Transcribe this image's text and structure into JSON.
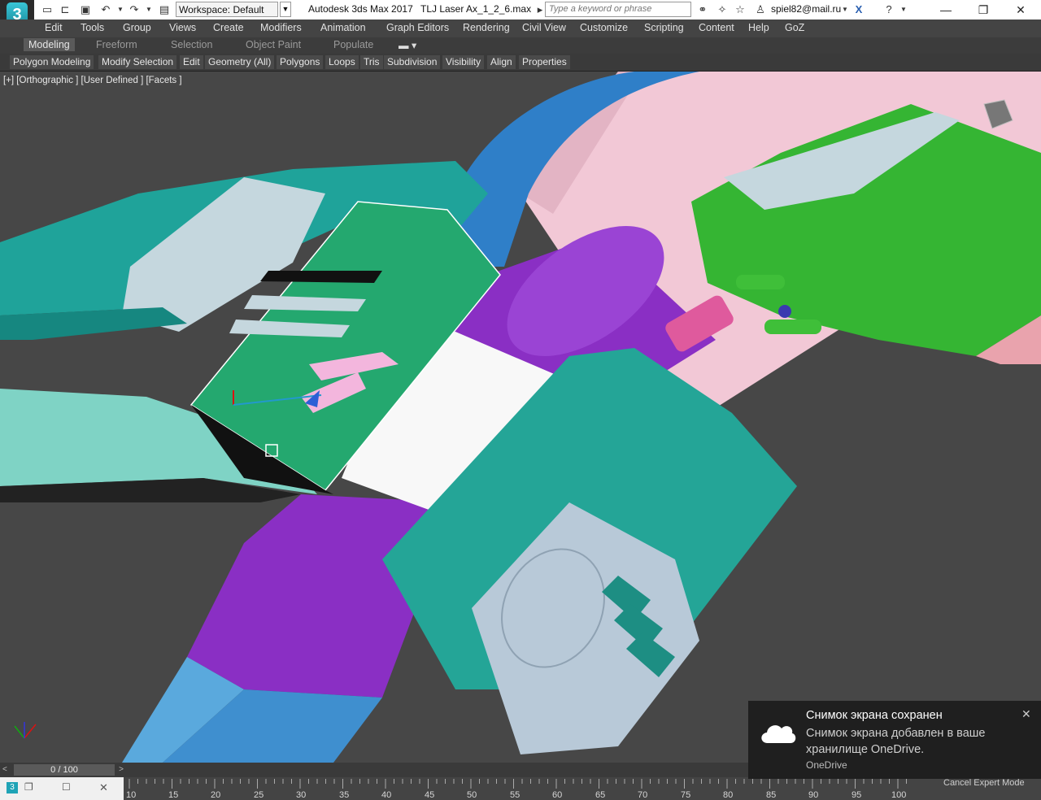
{
  "app_icon_label": "3",
  "title_bar": {
    "workspace": "Workspace: Default",
    "app_title": "Autodesk 3ds Max 2017",
    "file_name": "TLJ Laser Ax_1_2_6.max",
    "search_placeholder": "Type a keyword or phrase",
    "user": "spiel82@mail.ru"
  },
  "menu": [
    "Edit",
    "Tools",
    "Group",
    "Views",
    "Create",
    "Modifiers",
    "Animation",
    "Graph Editors",
    "Rendering",
    "Civil View",
    "Customize",
    "Scripting",
    "Content",
    "Help",
    "GoZ"
  ],
  "ribbon_tabs": [
    "Modeling",
    "Freeform",
    "Selection",
    "Object Paint",
    "Populate"
  ],
  "ribbon_buttons": [
    "Polygon Modeling",
    "Modify Selection",
    "Edit",
    "Geometry (All)",
    "Polygons",
    "Loops",
    "Tris",
    "Subdivision",
    "Visibility",
    "Align",
    "Properties"
  ],
  "viewport": {
    "label": "[+] [Orthographic ] [User Defined ] [Facets ]"
  },
  "timeline": {
    "position": "0 / 100",
    "ticks": [
      "10",
      "15",
      "20",
      "25",
      "30",
      "35",
      "40",
      "45",
      "50",
      "55",
      "60",
      "65",
      "70",
      "75",
      "80",
      "85",
      "90",
      "95",
      "100"
    ]
  },
  "status": {
    "cancel_expert_mode": "Cancel Expert Mode"
  },
  "notification": {
    "title": "Снимок экрана сохранен",
    "body": "Снимок экрана добавлен в ваше хранилище OneDrive.",
    "source": "OneDrive"
  },
  "colors": {
    "teal": "#2aa79a",
    "purple": "#8a2fc4",
    "green": "#35b533",
    "pink": "#f1c6d4",
    "blue": "#2f7fc8",
    "light_gray": "#b8c9d8",
    "viewport_bg": "#474747"
  }
}
